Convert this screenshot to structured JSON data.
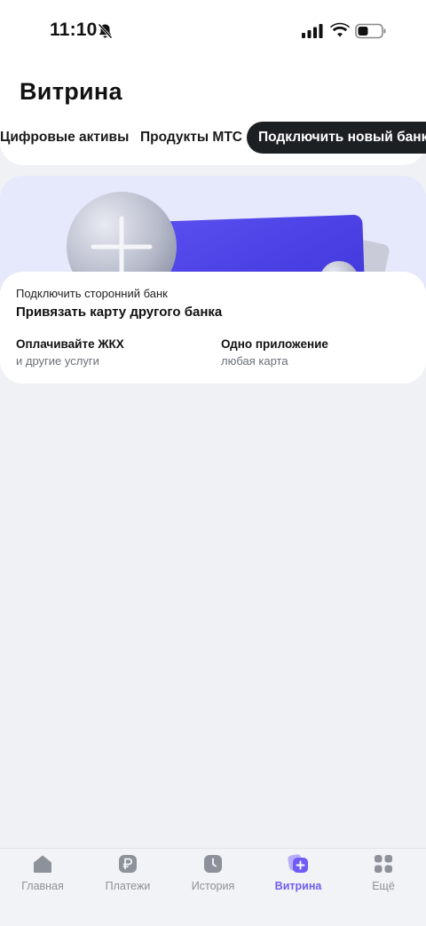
{
  "status_bar": {
    "time": "11:10"
  },
  "page_title": "Витрина",
  "tabs": [
    {
      "label": "Цифровые активы"
    },
    {
      "label": "Продукты МТС"
    },
    {
      "label": "Подключить новый банк",
      "active": true
    }
  ],
  "promo": {
    "overline": "Подключить сторонний банк",
    "title": "Привязать карту другого банка",
    "features": [
      {
        "title": "Оплачивайте ЖКХ",
        "subtitle": "и другие услуги"
      },
      {
        "title": "Одно приложение",
        "subtitle": "любая карта"
      }
    ]
  },
  "bottom_nav": [
    {
      "label": "Главная",
      "icon": "home-icon"
    },
    {
      "label": "Платежи",
      "icon": "ruble-icon"
    },
    {
      "label": "История",
      "icon": "clock-icon"
    },
    {
      "label": "Витрина",
      "icon": "showcase-icon",
      "active": true
    },
    {
      "label": "Ещё",
      "icon": "grid-icon"
    }
  ],
  "colors": {
    "accent": "#6E5CF5",
    "active_tab_bg": "#1D2023",
    "background": "#EFF1F5",
    "promo_bg": "#E6E8FB"
  }
}
